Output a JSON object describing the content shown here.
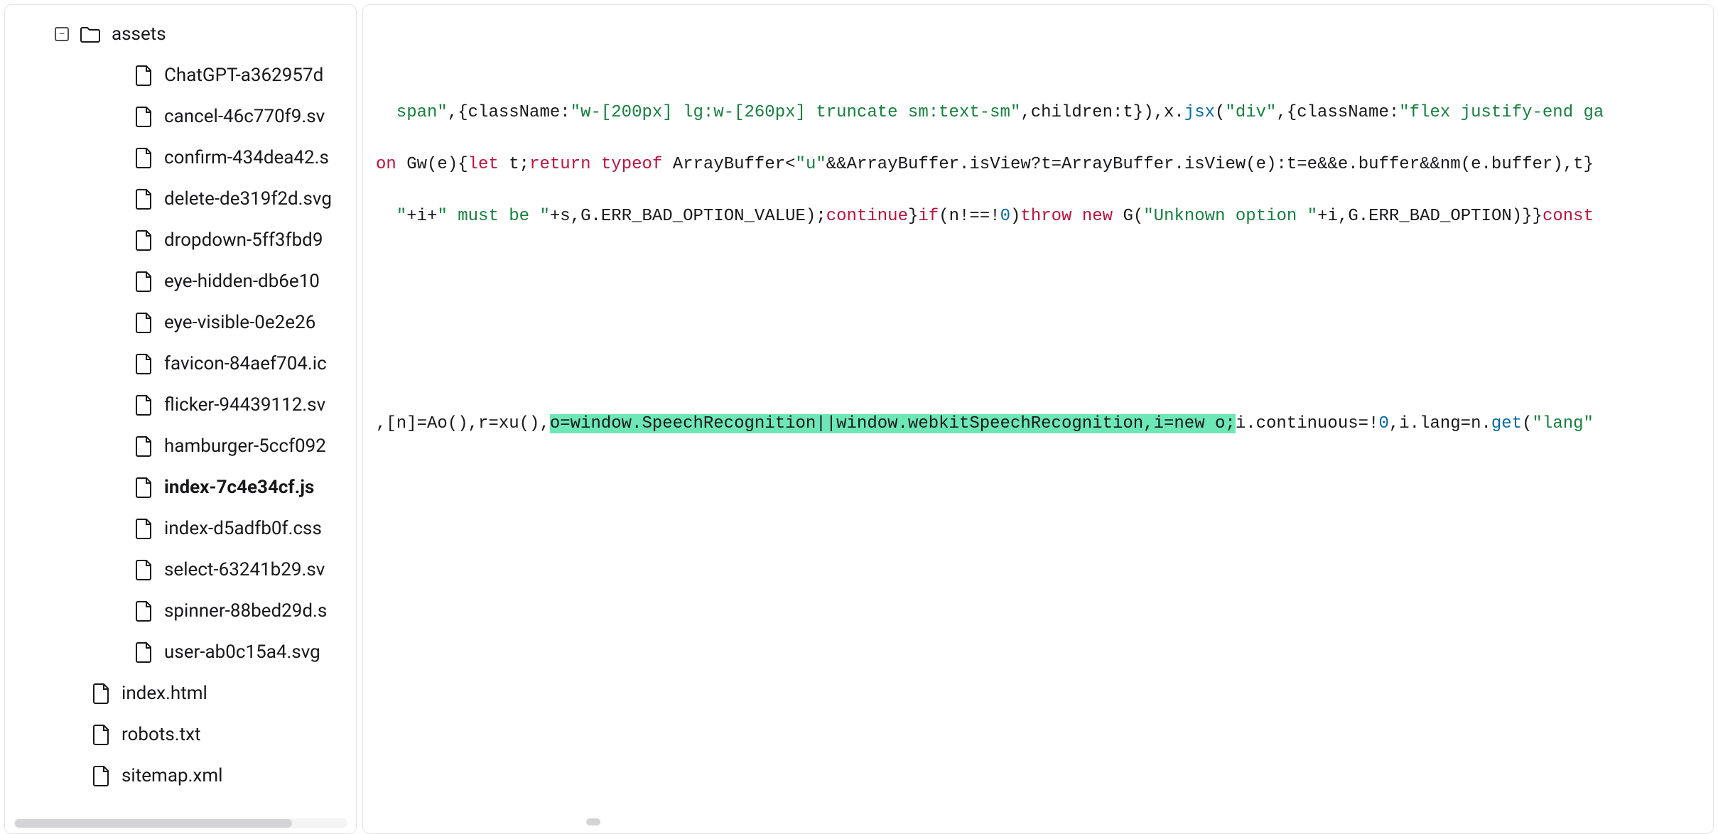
{
  "tree": {
    "folder_name": "assets",
    "toggle_glyph": "−",
    "children": [
      {
        "name": "ChatGPT-a362957d"
      },
      {
        "name": "cancel-46c770f9.sv"
      },
      {
        "name": "confirm-434dea42.s"
      },
      {
        "name": "delete-de319f2d.svg"
      },
      {
        "name": "dropdown-5ff3fbd9"
      },
      {
        "name": "eye-hidden-db6e10"
      },
      {
        "name": "eye-visible-0e2e26"
      },
      {
        "name": "favicon-84aef704.ic"
      },
      {
        "name": "flicker-94439112.sv"
      },
      {
        "name": "hamburger-5ccf092"
      },
      {
        "name": "index-7c4e34cf.js",
        "active": true
      },
      {
        "name": "index-d5adfb0f.css"
      },
      {
        "name": "select-63241b29.sv"
      },
      {
        "name": "spinner-88bed29d.s"
      },
      {
        "name": "user-ab0c15a4.svg"
      }
    ],
    "root_siblings": [
      {
        "name": "index.html"
      },
      {
        "name": "robots.txt"
      },
      {
        "name": "sitemap.xml"
      }
    ]
  },
  "code": {
    "lines": [
      {
        "indent": 2,
        "tokens": [
          {
            "text": "span\"",
            "cls": "tok-str"
          },
          {
            "text": ",{className:",
            "cls": "tok-punc"
          },
          {
            "text": "\"w-[200px] lg:w-[260px] truncate sm:text-sm\"",
            "cls": "tok-str"
          },
          {
            "text": ",children:t}),x.",
            "cls": "tok-punc"
          },
          {
            "text": "jsx",
            "cls": "tok-fn"
          },
          {
            "text": "(",
            "cls": "tok-punc"
          },
          {
            "text": "\"div\"",
            "cls": "tok-str"
          },
          {
            "text": ",{className:",
            "cls": "tok-punc"
          },
          {
            "text": "\"flex justify-end ga",
            "cls": "tok-str"
          }
        ]
      },
      {
        "indent": 0,
        "tokens": [
          {
            "text": "on",
            "cls": "tok-kw"
          },
          {
            "text": " Gw(e){",
            "cls": "tok-punc"
          },
          {
            "text": "let",
            "cls": "tok-kw"
          },
          {
            "text": " t;",
            "cls": "tok-punc"
          },
          {
            "text": "return typeof",
            "cls": "tok-kw"
          },
          {
            "text": " ArrayBuffer<",
            "cls": "tok-punc"
          },
          {
            "text": "\"u\"",
            "cls": "tok-str"
          },
          {
            "text": "&&ArrayBuffer.isView?t=ArrayBuffer.isView(e):t=e&&e.buffer&&nm(e.buffer),t}",
            "cls": "tok-punc"
          }
        ]
      },
      {
        "indent": 2,
        "tokens": [
          {
            "text": "\"",
            "cls": "tok-str"
          },
          {
            "text": "+i+",
            "cls": "tok-punc"
          },
          {
            "text": "\" must be \"",
            "cls": "tok-str"
          },
          {
            "text": "+s,G.ERR_BAD_OPTION_VALUE);",
            "cls": "tok-punc"
          },
          {
            "text": "continue",
            "cls": "tok-kw"
          },
          {
            "text": "}",
            "cls": "tok-punc"
          },
          {
            "text": "if",
            "cls": "tok-kw"
          },
          {
            "text": "(n!==!",
            "cls": "tok-punc"
          },
          {
            "text": "0",
            "cls": "tok-num"
          },
          {
            "text": ")",
            "cls": "tok-punc"
          },
          {
            "text": "throw new",
            "cls": "tok-kw"
          },
          {
            "text": " G(",
            "cls": "tok-punc"
          },
          {
            "text": "\"Unknown option \"",
            "cls": "tok-str"
          },
          {
            "text": "+i,G.ERR_BAD_OPTION)}}",
            "cls": "tok-punc"
          },
          {
            "text": "const",
            "cls": "tok-kw"
          }
        ]
      },
      {
        "indent": 0,
        "tokens": []
      },
      {
        "indent": 0,
        "tokens": []
      },
      {
        "indent": 0,
        "tokens": []
      },
      {
        "indent": 0,
        "tokens": [
          {
            "text": ",[n]=Ao(),r=xu(),",
            "cls": "tok-punc"
          },
          {
            "text": "o=window.SpeechRecognition||window.webkitSpeechRecognition,i=new o;",
            "cls": "tok-punc",
            "hl": true
          },
          {
            "text": "i.continuous=!",
            "cls": "tok-punc"
          },
          {
            "text": "0",
            "cls": "tok-num"
          },
          {
            "text": ",i.lang=n.",
            "cls": "tok-punc"
          },
          {
            "text": "get",
            "cls": "tok-fn"
          },
          {
            "text": "(",
            "cls": "tok-punc"
          },
          {
            "text": "\"lang\"",
            "cls": "tok-str"
          }
        ]
      }
    ]
  }
}
